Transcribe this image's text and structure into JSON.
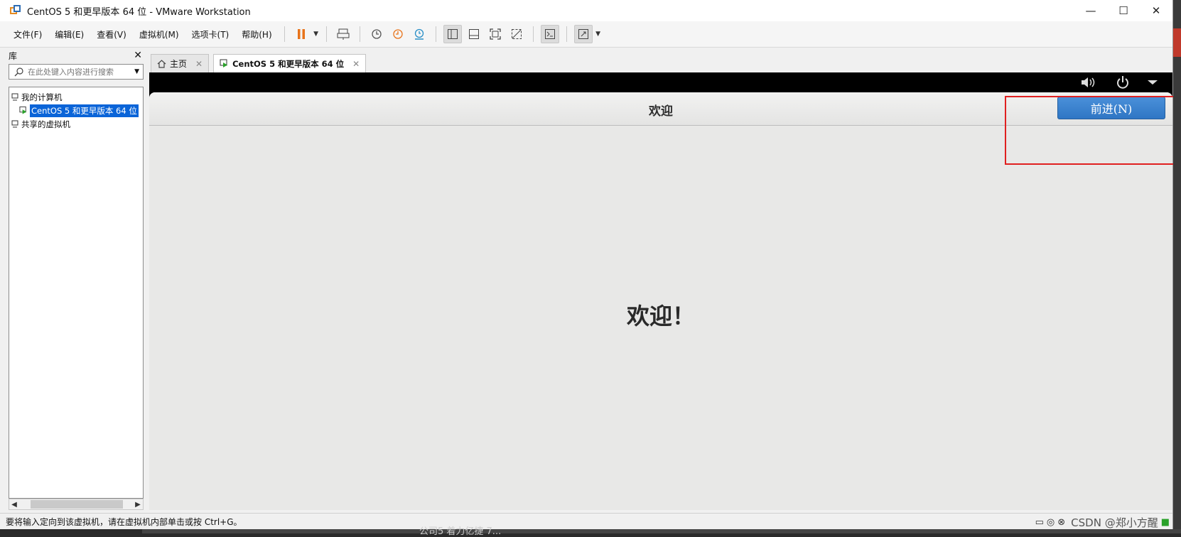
{
  "window": {
    "title": "CentOS 5 和更早版本 64 位 - VMware Workstation",
    "minimize": "—",
    "maximize": "☐",
    "close": "✕"
  },
  "menu": {
    "file": "文件(F)",
    "edit": "编辑(E)",
    "view": "查看(V)",
    "vm": "虚拟机(M)",
    "tabs": "选项卡(T)",
    "help": "帮助(H)"
  },
  "library": {
    "title": "库",
    "close": "✕",
    "search_placeholder": "在此处键入内容进行搜索",
    "tree": {
      "my_computer": "我的计算机",
      "vm_item": "CentOS 5 和更早版本 64 位",
      "shared": "共享的虚拟机"
    }
  },
  "tabs": {
    "home": "主页",
    "vm": "CentOS 5 和更早版本 64 位",
    "close": "✕"
  },
  "installer": {
    "header_title": "欢迎",
    "forward_button": "前进(N)",
    "welcome_text": "欢迎！"
  },
  "statusbar": {
    "text": "要将输入定向到该虚拟机，请在虚拟机内部单击或按 Ctrl+G。",
    "watermark": "CSDN @郑小方醒"
  },
  "background": {
    "partial_text": "公司5 着力亿捷 7..."
  },
  "colors": {
    "accent": "#0a64d8",
    "forward_button": "#3a82cf",
    "highlight": "#e02020",
    "pause": "#e8731a"
  }
}
